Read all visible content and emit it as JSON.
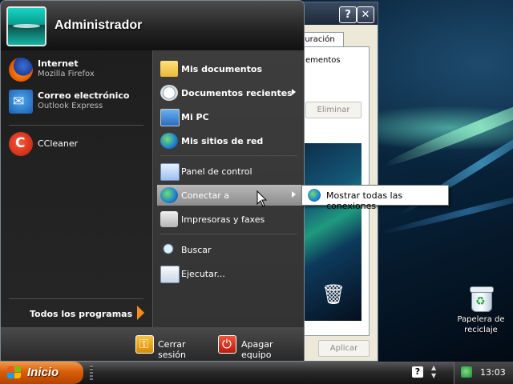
{
  "user": {
    "name": "Administrador"
  },
  "left_items": [
    {
      "title": "Internet",
      "subtitle": "Mozilla Firefox",
      "icon": "firefox-icon"
    },
    {
      "title": "Correo electrónico",
      "subtitle": "Outlook Express",
      "icon": "outlook-express-icon"
    },
    {
      "title": "CCleaner",
      "icon": "ccleaner-icon"
    }
  ],
  "all_programs": {
    "label": "Todos los programas"
  },
  "right_items": [
    {
      "label": "Mis documentos",
      "bold": true,
      "icon": "my-documents-icon"
    },
    {
      "label": "Documentos recientes",
      "bold": true,
      "submenu": true,
      "icon": "recent-documents-icon"
    },
    {
      "label": "Mi PC",
      "bold": true,
      "icon": "my-computer-icon"
    },
    {
      "label": "Mis sitios de red",
      "bold": true,
      "icon": "network-places-icon"
    },
    {
      "label": "Panel de control",
      "icon": "control-panel-icon"
    },
    {
      "label": "Conectar a",
      "submenu": true,
      "highlighted": true,
      "icon": "connect-to-icon"
    },
    {
      "label": "Impresoras y faxes",
      "icon": "printers-icon"
    },
    {
      "label": "Buscar",
      "icon": "search-icon"
    },
    {
      "label": "Ejecutar...",
      "icon": "run-icon"
    }
  ],
  "footer": {
    "logoff": "Cerrar sesión",
    "shutdown": "Apagar equipo"
  },
  "submenu": {
    "label": "Mostrar todas las conexiones",
    "icon": "network-connections-icon"
  },
  "background_window": {
    "help": "?",
    "close": "✕",
    "tab": "guración",
    "text": "ementos",
    "eliminar": "Eliminar",
    "aplicar": "Aplicar"
  },
  "desktop": {
    "recycle_bin": "Papelera de reciclaje"
  },
  "taskbar": {
    "start": "Inicio",
    "help_icon": "?",
    "clock": "13:03"
  },
  "colors": {
    "start_button": "#d95e08",
    "menu_highlight": "#9a9a9a",
    "all_programs_arrow": "#f28e16"
  }
}
